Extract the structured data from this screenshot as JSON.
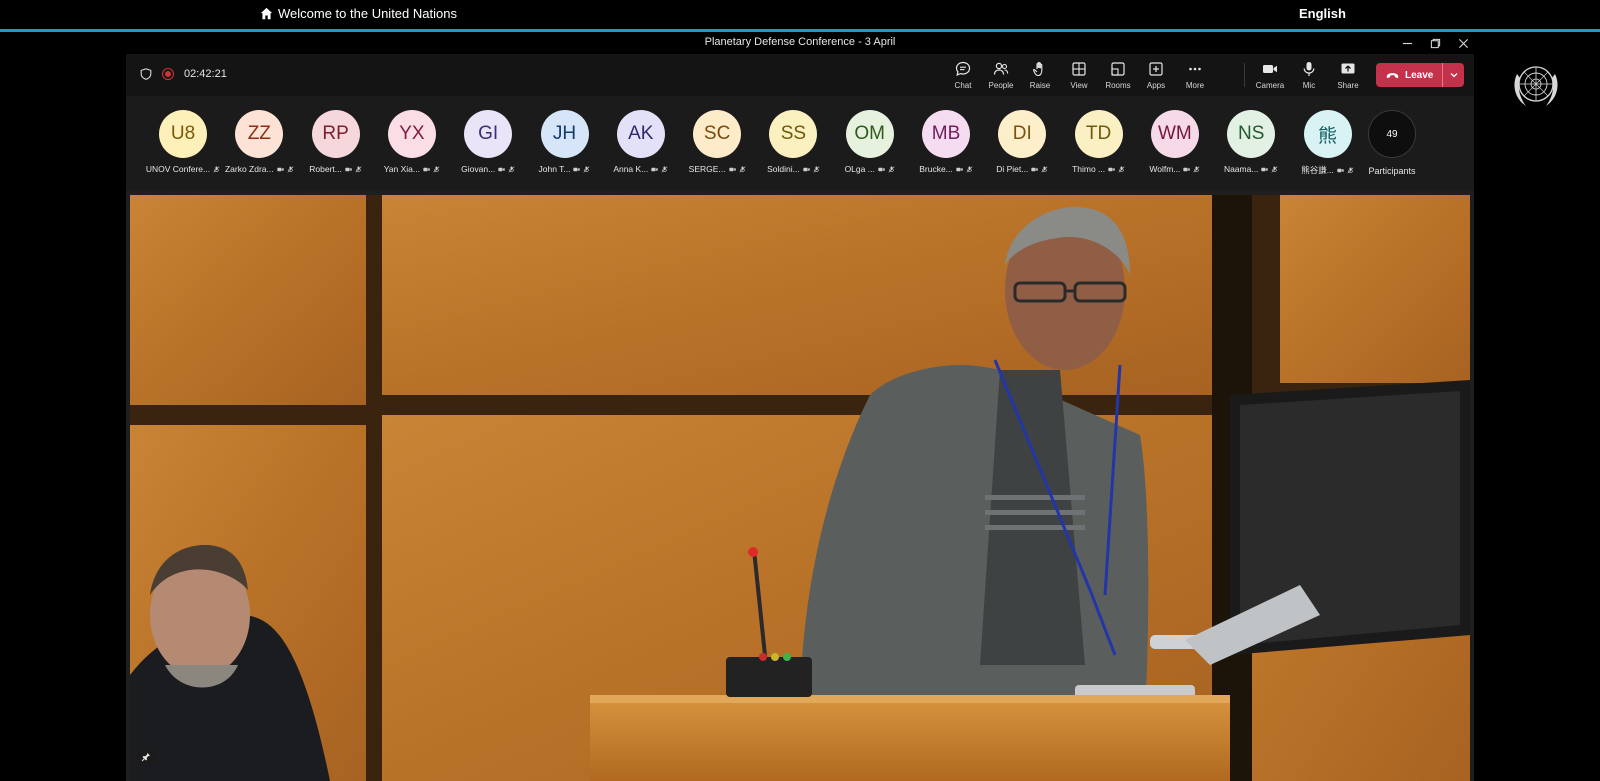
{
  "site": {
    "home_label": "Welcome to the United Nations",
    "language": "English"
  },
  "window": {
    "title": "Planetary Defense Conference - 3 April"
  },
  "toolbar": {
    "timer": "02:42:21",
    "buttons": [
      {
        "label": "Chat",
        "icon": "chat-icon"
      },
      {
        "label": "People",
        "icon": "people-icon"
      },
      {
        "label": "Raise",
        "icon": "raise-hand-icon"
      },
      {
        "label": "View",
        "icon": "view-grid-icon"
      },
      {
        "label": "Rooms",
        "icon": "rooms-icon"
      },
      {
        "label": "Apps",
        "icon": "apps-icon"
      },
      {
        "label": "More",
        "icon": "more-icon"
      },
      {
        "label": "Camera",
        "icon": "camera-icon"
      },
      {
        "label": "Mic",
        "icon": "mic-icon"
      },
      {
        "label": "Share",
        "icon": "share-icon"
      }
    ],
    "leave_label": "Leave"
  },
  "participants": {
    "count": "49",
    "count_label": "Participants",
    "list": [
      {
        "initials": "U8",
        "name": "UNOV Confere...",
        "color": "#fdf0b8",
        "text_color": "#7a5b0c"
      },
      {
        "initials": "ZZ",
        "name": "Zarko Zdra...",
        "color": "#fde2d6",
        "text_color": "#8a2f12"
      },
      {
        "initials": "RP",
        "name": "Robert...",
        "color": "#f6d8dc",
        "text_color": "#7a1f2b"
      },
      {
        "initials": "YX",
        "name": "Yan Xia...",
        "color": "#fbdde6",
        "text_color": "#7e1c3e"
      },
      {
        "initials": "GI",
        "name": "Giovan...",
        "color": "#e9e4f7",
        "text_color": "#3c2f73"
      },
      {
        "initials": "JH",
        "name": "John T...",
        "color": "#d6e6f8",
        "text_color": "#123c6b"
      },
      {
        "initials": "AK",
        "name": "Anna K...",
        "color": "#e3e1f8",
        "text_color": "#2f2a6e"
      },
      {
        "initials": "SC",
        "name": "SERGE...",
        "color": "#fdebc9",
        "text_color": "#7a4a0c"
      },
      {
        "initials": "SS",
        "name": "Soldini...",
        "color": "#fbf0bf",
        "text_color": "#6f5a0b"
      },
      {
        "initials": "OM",
        "name": "OLga ...",
        "color": "#e6f2de",
        "text_color": "#2f5a1e"
      },
      {
        "initials": "MB",
        "name": "Brucke...",
        "color": "#f6dcf0",
        "text_color": "#6e1f5e"
      },
      {
        "initials": "DI",
        "name": "Di Piet...",
        "color": "#fdefc9",
        "text_color": "#7a5210"
      },
      {
        "initials": "TD",
        "name": "Thimo ...",
        "color": "#fbf0c4",
        "text_color": "#6e5a0e"
      },
      {
        "initials": "WM",
        "name": "Wolfm...",
        "color": "#f7dae8",
        "text_color": "#73183f"
      },
      {
        "initials": "NS",
        "name": "Naama...",
        "color": "#e3f1e4",
        "text_color": "#245a2f"
      },
      {
        "initials": "熊",
        "name": "熊谷謙...",
        "color": "#d9f3f4",
        "text_color": "#0f5d63"
      }
    ]
  }
}
